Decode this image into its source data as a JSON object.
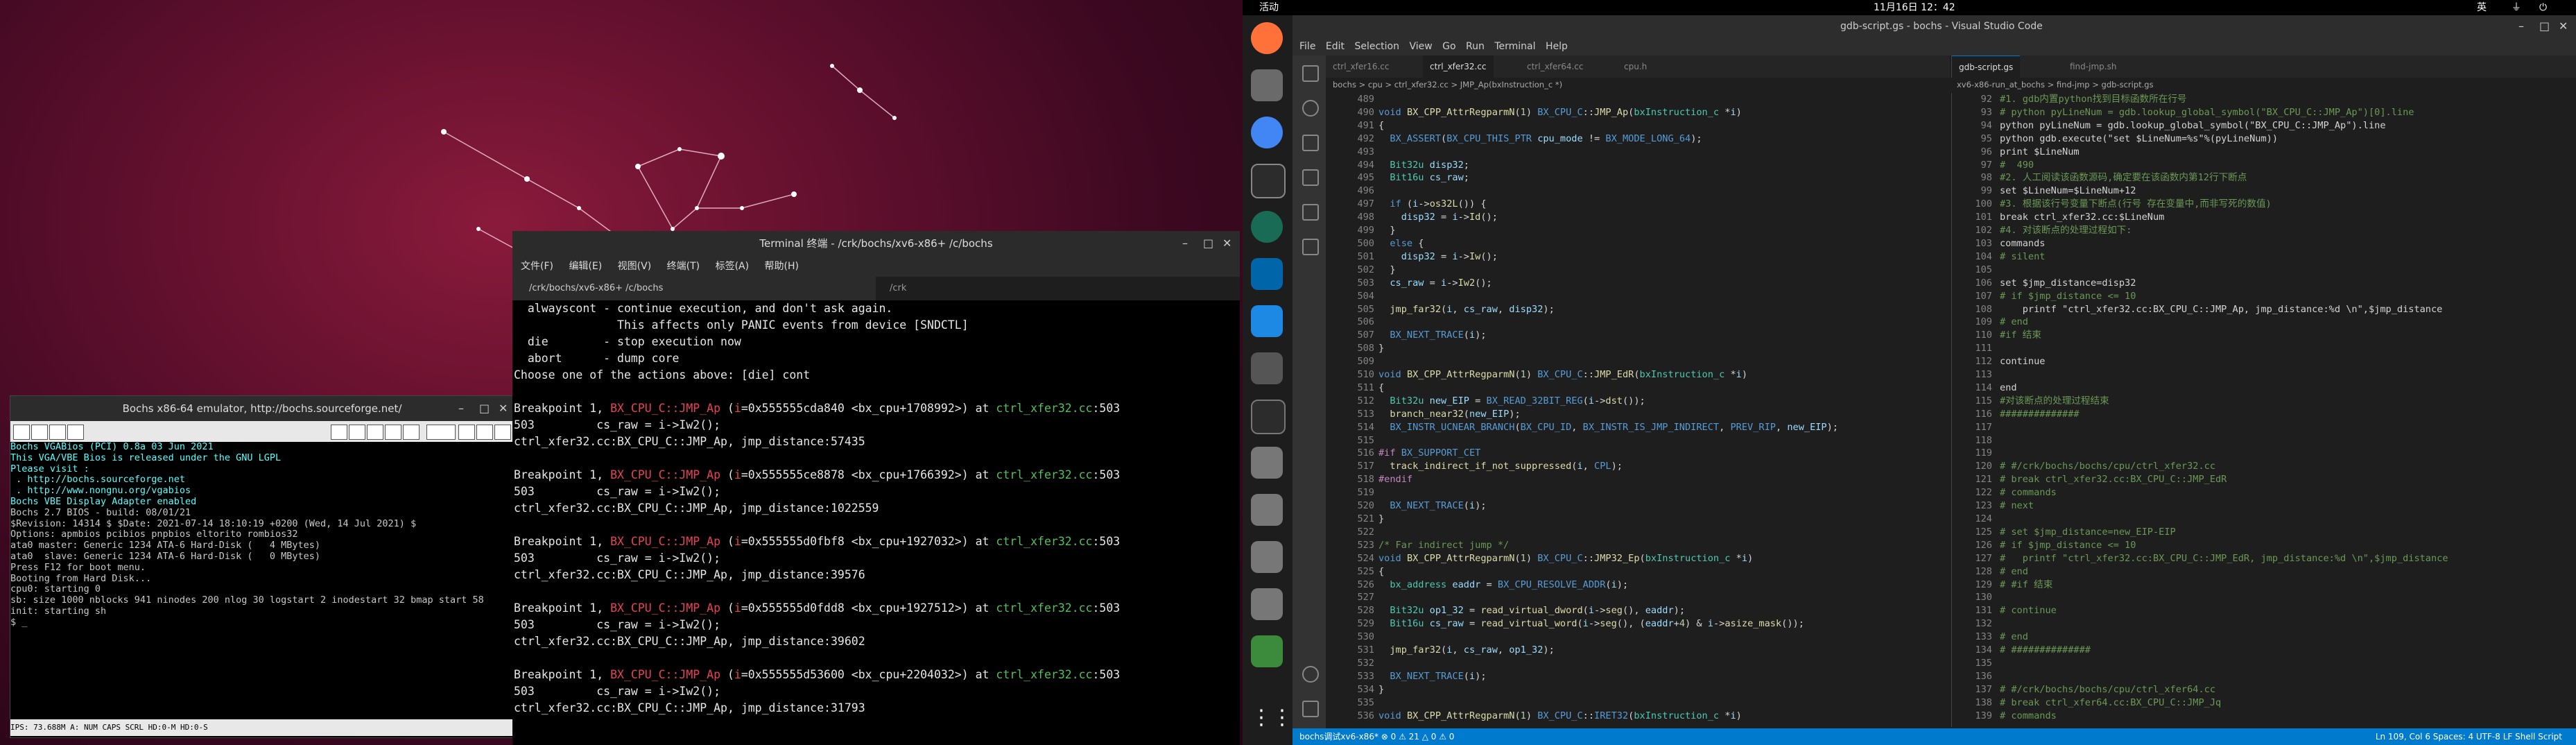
{
  "topbar": {
    "activities": "活动",
    "clock": "11月16日 12：42"
  },
  "bochs": {
    "title": "Bochs x86-64 emulator, http://bochs.sourceforge.net/",
    "screen_lines": [
      "Bochs VGABios (PCI) 0.8a 03 Jun 2021",
      "This VGA/VBE Bios is released under the GNU LGPL",
      "",
      "Please visit :",
      " . http://bochs.sourceforge.net",
      " . http://www.nongnu.org/vgabios",
      "",
      "Bochs VBE Display Adapter enabled",
      "",
      "Bochs 2.7 BIOS - build: 08/01/21",
      "$Revision: 14314 $ $Date: 2021-07-14 18:10:19 +0200 (Wed, 14 Jul 2021) $",
      "Options: apmbios pcibios pnpbios eltorito rombios32",
      "",
      "ata0 master: Generic 1234 ATA-6 Hard-Disk (   4 MBytes)",
      "ata0  slave: Generic 1234 ATA-6 Hard-Disk (   0 MBytes)",
      "",
      "Press F12 for boot menu.",
      "",
      "Booting from Hard Disk...",
      "cpu0: starting 0",
      "sb: size 1000 nblocks 941 ninodes 200 nlog 30 logstart 2 inodestart 32 bmap start 58",
      "init: starting sh",
      "$ _"
    ],
    "status": "IPS: 73.688M    A:  NUM   CAPS  SCRL  HD:0-M  HD:0-S"
  },
  "terminal": {
    "title": "Terminal 终端 - /crk/bochs/xv6-x86+ /c/bochs",
    "menu": [
      "文件(F)",
      "编辑(E)",
      "视图(V)",
      "终端(T)",
      "标签(A)",
      "帮助(H)"
    ],
    "tabs": [
      "/crk/bochs/xv6-x86+ /c/bochs",
      "/crk"
    ],
    "intro_lines": [
      "  alwayscont - continue execution, and don't ask again.",
      "               This affects only PANIC events from device [SNDCTL]",
      "  die        - stop execution now",
      "  abort      - dump core",
      "Choose one of the actions above: [die] cont"
    ],
    "breakpoints": [
      {
        "addr": "0x555555cda840",
        "cpu": "<bx_cpu+1708992>",
        "dist": "57435"
      },
      {
        "addr": "0x555555ce8878",
        "cpu": "<bx_cpu+1766392>",
        "dist": "1022559"
      },
      {
        "addr": "0x555555d0fbf8",
        "cpu": "<bx_cpu+1927032>",
        "dist": "39576"
      },
      {
        "addr": "0x555555d0fdd8",
        "cpu": "<bx_cpu+1927512>",
        "dist": "39602"
      },
      {
        "addr": "0x555555d53600",
        "cpu": "<bx_cpu+2204032>",
        "dist": "31793"
      }
    ],
    "bp_prefix": "Breakpoint 1, ",
    "bp_func": "BX_CPU_C::JMP_Ap",
    "bp_at": " at ",
    "bp_file": "ctrl_xfer32.cc",
    "bp_line": ":503",
    "src_line": "503         cs_raw = i->Iw2();",
    "dist_prefix": "ctrl_xfer32.cc:BX_CPU_C::JMP_Ap, jmp_distance:"
  },
  "vscode": {
    "title": "gdb-script.gs - bochs - Visual Studio Code",
    "menu": [
      "File",
      "Edit",
      "Selection",
      "View",
      "Go",
      "Run",
      "Terminal",
      "Help"
    ],
    "left_tabs": [
      "ctrl_xfer16.cc",
      "ctrl_xfer32.cc",
      "ctrl_xfer64.cc",
      "cpu.h"
    ],
    "right_tabs": [
      "gdb-script.gs",
      "find-jmp.sh"
    ],
    "left_crumb": "bochs > cpu > ctrl_xfer32.cc > JMP_Ap(bxInstruction_c *)",
    "right_crumb": "xv6-x86-run_at_bochs > find-jmp > gdb-script.gs",
    "left_start": 489,
    "left_code": [
      "",
      "void BX_CPP_AttrRegparmN(1) BX_CPU_C::JMP_Ap(bxInstruction_c *i)",
      "{",
      "  BX_ASSERT(BX_CPU_THIS_PTR cpu_mode != BX_MODE_LONG_64);",
      "",
      "  Bit32u disp32;",
      "  Bit16u cs_raw;",
      "",
      "  if (i->os32L()) {",
      "    disp32 = i->Id();",
      "  }",
      "  else {",
      "    disp32 = i->Iw();",
      "  }",
      "  cs_raw = i->Iw2();",
      "",
      "  jmp_far32(i, cs_raw, disp32);",
      "",
      "  BX_NEXT_TRACE(i);",
      "}",
      "",
      "void BX_CPP_AttrRegparmN(1) BX_CPU_C::JMP_EdR(bxInstruction_c *i)",
      "{",
      "  Bit32u new_EIP = BX_READ_32BIT_REG(i->dst());",
      "  branch_near32(new_EIP);",
      "  BX_INSTR_UCNEAR_BRANCH(BX_CPU_ID, BX_INSTR_IS_JMP_INDIRECT, PREV_RIP, new_EIP);",
      "",
      "#if BX_SUPPORT_CET",
      "  track_indirect_if_not_suppressed(i, CPL);",
      "#endif",
      "",
      "  BX_NEXT_TRACE(i);",
      "}",
      "",
      "/* Far indirect jump */",
      "void BX_CPP_AttrRegparmN(1) BX_CPU_C::JMP32_Ep(bxInstruction_c *i)",
      "{",
      "  bx_address eaddr = BX_CPU_RESOLVE_ADDR(i);",
      "",
      "  Bit32u op1_32 = read_virtual_dword(i->seg(), eaddr);",
      "  Bit16u cs_raw = read_virtual_word(i->seg(), (eaddr+4) & i->asize_mask());",
      "",
      "  jmp_far32(i, cs_raw, op1_32);",
      "",
      "  BX_NEXT_TRACE(i);",
      "}",
      "",
      "void BX_CPP_AttrRegparmN(1) BX_CPU_C::IRET32(bxInstruction_c *i)"
    ],
    "right_start": 92,
    "right_code": [
      "#1. gdb内置python找到目标函数所在行号",
      "# python pyLineNum = gdb.lookup_global_symbol(\"BX_CPU_C::JMP_Ap\")[0].line",
      "python pyLineNum = gdb.lookup_global_symbol(\"BX_CPU_C::JMP_Ap\").line",
      "python gdb.execute(\"set $LineNum=%s\"%(pyLineNum))",
      "print $LineNum",
      "#  490",
      "#2. 人工阅读该函数源码,确定要在该函数内第12行下断点",
      "set $LineNum=$LineNum+12",
      "#3. 根据该行号变量下断点(行号 存在变量中,而非写死的数值)",
      "break ctrl_xfer32.cc:$LineNum",
      "#4. 对该断点的处理过程如下:",
      "commands",
      "# silent",
      "",
      "set $jmp_distance=disp32",
      "# if $jmp_distance <= 10",
      "    printf \"ctrl_xfer32.cc:BX_CPU_C::JMP_Ap, jmp_distance:%d \\n\",$jmp_distance",
      "# end",
      "#if 结束",
      "",
      "continue",
      "",
      "end",
      "#对该断点的处理过程结束",
      "##############",
      "",
      "",
      "",
      "# #/crk/bochs/bochs/cpu/ctrl_xfer32.cc",
      "# break ctrl_xfer32.cc:BX_CPU_C::JMP_EdR",
      "# commands",
      "# next",
      "",
      "# set $jmp_distance=new_EIP-EIP",
      "# if $jmp_distance <= 10",
      "#   printf \"ctrl_xfer32.cc:BX_CPU_C::JMP_EdR, jmp_distance:%d \\n\",$jmp_distance",
      "# end",
      "# #if 结束",
      "",
      "# continue",
      "",
      "# end",
      "# ##############",
      "",
      "",
      "# #/crk/bochs/bochs/cpu/ctrl_xfer64.cc",
      "# break ctrl_xfer64.cc:BX_CPU_C::JMP_Jq",
      "# commands"
    ],
    "status_left": "bochs调试xv6-x86*  ⊗ 0 ⚠ 21  △ 0  ⚠ 0",
    "status_right": "Ln 109, Col 6   Spaces: 4   UTF-8   LF   Shell Script"
  }
}
